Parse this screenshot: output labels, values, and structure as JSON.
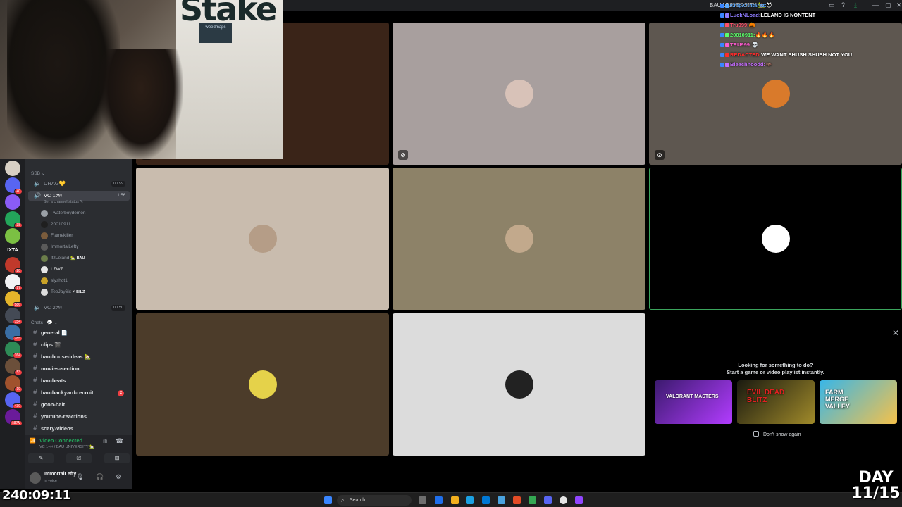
{
  "window": {
    "title": "BAU UNIVERSITY 🏡"
  },
  "stream_chat": [
    {
      "user": "KingXAntarez:",
      "message": "😈",
      "color": "#5aa9ff"
    },
    {
      "user": "LuckNLoad:",
      "message": "LELAND IS NONTENT",
      "color": "#8e7cff"
    },
    {
      "user": "Tru999:",
      "message": "🎃",
      "color": "#ff4f6b"
    },
    {
      "user": "20010911:",
      "message": "🔥🔥🔥",
      "color": "#5aff6a"
    },
    {
      "user": "TRU999:",
      "message": "💀",
      "color": "#ff5ad0"
    },
    {
      "user": "REDACTED:",
      "message": "WE WANT SHUSH SHUSH NOT YOU",
      "color": "#ff2a2a"
    },
    {
      "user": "Bleachhoodd:",
      "message": "🦇",
      "color": "#c36bff"
    }
  ],
  "server_rail": {
    "items": [
      {
        "badge": "",
        "color": "#d8d0c4"
      },
      {
        "badge": "40",
        "color": "#5865f2"
      },
      {
        "badge": "",
        "color": "#8a5cf5"
      },
      {
        "badge": "38",
        "color": "#23a55a"
      },
      {
        "badge": "",
        "color": "#7bc043"
      }
    ],
    "text_item": "IXTA",
    "more_items": [
      {
        "badge": "20",
        "color": "#c0392b"
      },
      {
        "badge": "27",
        "color": "#f2f3f5"
      },
      {
        "badge": "586",
        "color": "#e4b42a"
      },
      {
        "badge": "154",
        "color": "#444a55"
      },
      {
        "badge": "285",
        "color": "#3a6ea5"
      },
      {
        "badge": "164",
        "color": "#2e8b57"
      },
      {
        "badge": "53",
        "color": "#6b4f3a"
      },
      {
        "badge": "19",
        "color": "#a0522d"
      },
      {
        "badge": "430",
        "color": "#5865f2"
      },
      {
        "badge": "NEW",
        "color": "#6a1b9a"
      }
    ]
  },
  "sidebar": {
    "category_top": "SSB ⌄",
    "voice_channels": [
      {
        "name": "DRAG💛",
        "tag": "00 99"
      },
      {
        "name": "VC 1🕬",
        "tag": "1:56",
        "status": "Set a channel status ✎"
      }
    ],
    "members": [
      {
        "name": "i waterboydemon",
        "color": "#9aa0a6"
      },
      {
        "name": "20010911",
        "color": "#1f1f1f"
      },
      {
        "name": "Flamekiller",
        "color": "#7b5c3c"
      },
      {
        "name": "ImmortalLefty",
        "color": "#5a5a5a"
      },
      {
        "name": "ItzLeland",
        "tag": "🏡 BAU",
        "color": "#6b7d4a"
      },
      {
        "name": "LZWZ",
        "color": "#e5e5e5"
      },
      {
        "name": "slyshot1",
        "color": "#c9a227"
      },
      {
        "name": "TeeJay6ix",
        "tag": "⚡ BILZ",
        "color": "#dcdcdc"
      }
    ],
    "vc2": {
      "name": "VC 2🕬",
      "tag": "00 50"
    },
    "category_chats": "Chats · 💬 ⌄",
    "text_channels": [
      {
        "name": "general 📄",
        "badge": ""
      },
      {
        "name": "clips 🎬",
        "badge": ""
      },
      {
        "name": "bau-house-ideas 🏡",
        "badge": ""
      },
      {
        "name": "movies-section",
        "badge": ""
      },
      {
        "name": "bau-beats",
        "badge": ""
      },
      {
        "name": "bau-backyard-recruit",
        "badge": "2"
      },
      {
        "name": "goon-bait",
        "badge": ""
      },
      {
        "name": "youtube-reactions",
        "badge": ""
      },
      {
        "name": "scary-videos",
        "badge": ""
      }
    ],
    "vc_panel": {
      "status": "Video Connected",
      "location": "VC 1🕬 / BAU UNIVERSITY 🏡"
    },
    "user_panel": {
      "name": "ImmortalLefty",
      "status": "In voice"
    }
  },
  "video_tiles": [
    {
      "bg": "#3a2418",
      "avatar": "",
      "mute": true
    },
    {
      "bg": "#a89f9e",
      "avatar": "#d8c2b8",
      "mute": true
    },
    {
      "bg": "#5e5750",
      "avatar": "#d97a2b",
      "mute": true
    },
    {
      "bg": "#c9bcae",
      "avatar": "#b59d87",
      "mute": false
    },
    {
      "bg": "#8d8268",
      "avatar": "#c2a98c",
      "mute": false
    },
    {
      "bg": "#000000",
      "avatar": "#ffffff",
      "mute": false
    },
    {
      "bg": "#4c3c2a",
      "avatar": "#e5d24a",
      "mute": false
    },
    {
      "bg": "#dcdcdc",
      "avatar": "#222222",
      "mute": false
    }
  ],
  "promo": {
    "title_line1": "Looking for something to do?",
    "title_line2": "Start a game or video playlist instantly.",
    "games": [
      {
        "name": "VALORANT MASTERS",
        "color1": "#3b1a6e",
        "color2": "#b23cff"
      },
      {
        "name": "EVIL DEAD BLITZ",
        "color1": "#1a1a10",
        "color2": "#a08a2a"
      },
      {
        "name": "FARM MERGE VALLEY",
        "color1": "#38b6e8",
        "color2": "#f5c14a"
      }
    ],
    "dont_show": "Don't show again"
  },
  "taskbar": {
    "search_placeholder": "Search"
  },
  "overlay": {
    "timer": "240:09:11",
    "day_line1": "DAY",
    "day_line2": "11/15"
  }
}
